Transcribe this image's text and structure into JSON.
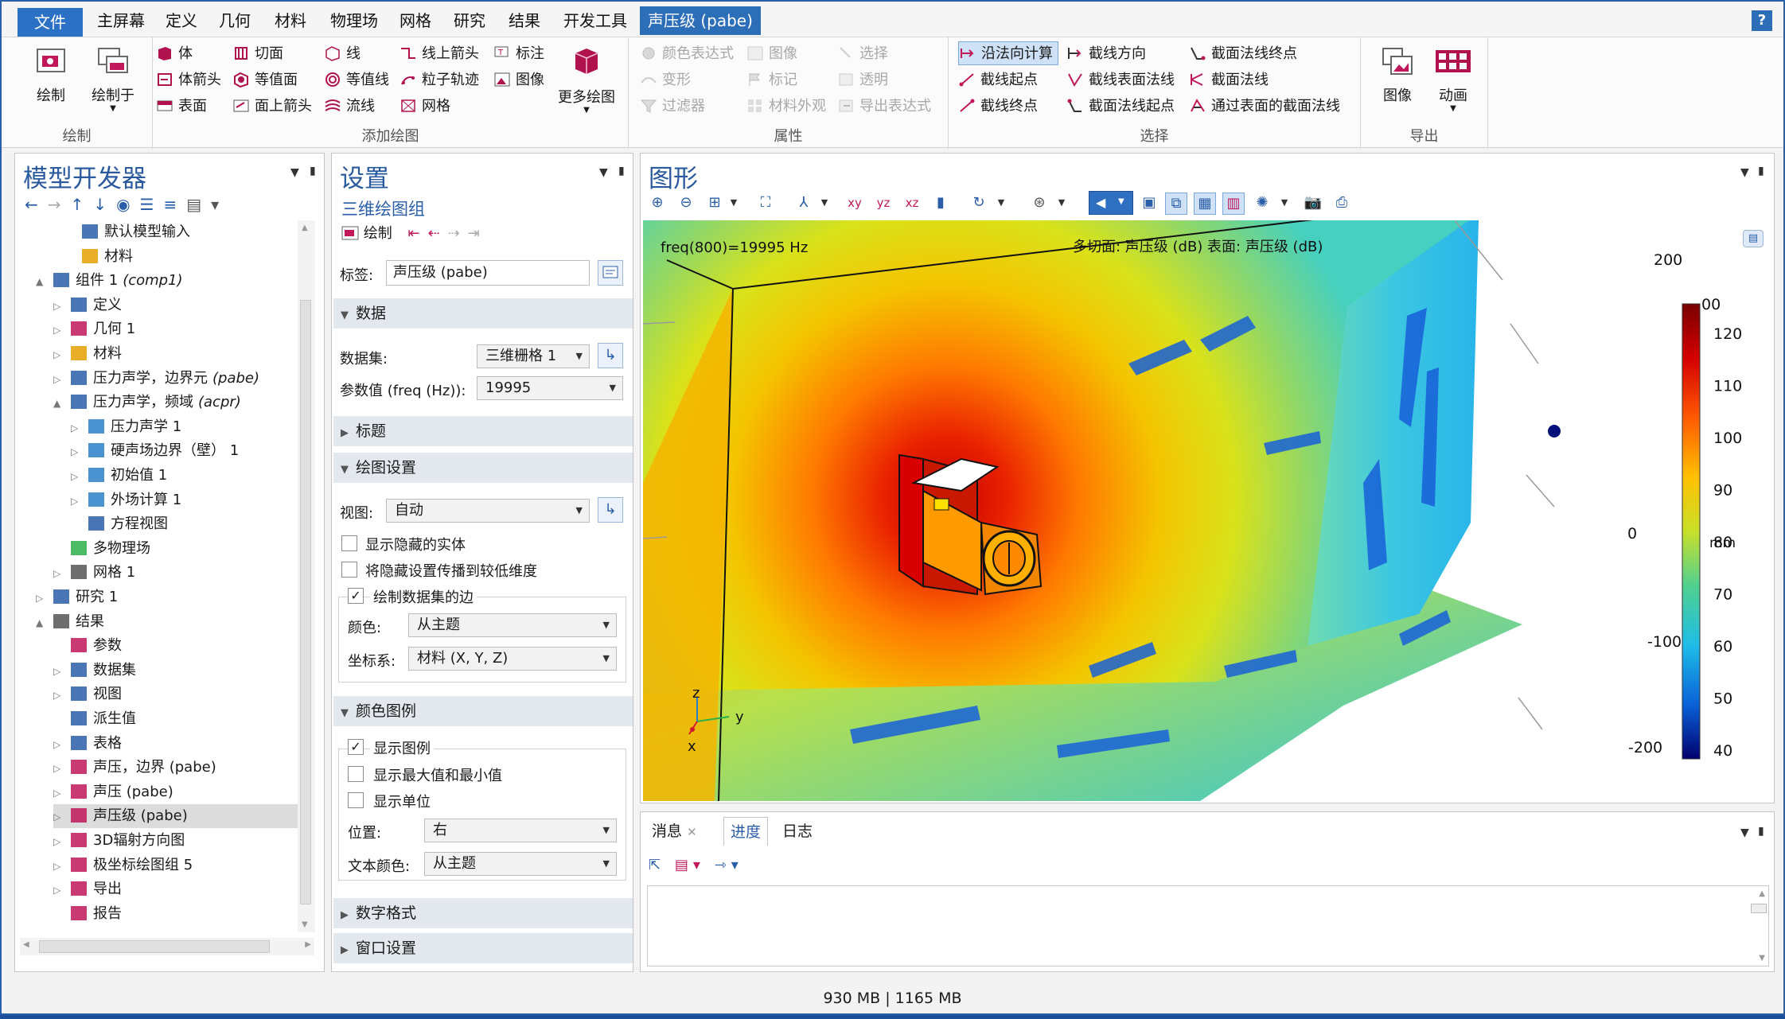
{
  "tabs": {
    "file": "文件",
    "home": "主屏幕",
    "definitions": "定义",
    "geometry": "几何",
    "materials": "材料",
    "physics": "物理场",
    "mesh": "网格",
    "study": "研究",
    "results": "结果",
    "developer": "开发工具",
    "contextual": "声压级 (pabe)",
    "help": "?"
  },
  "ribbon": {
    "plot_group": {
      "plot": "绘制",
      "plot_in": "绘制于",
      "label": "绘制"
    },
    "add_plot": {
      "label": "添加绘图",
      "col1": [
        "体",
        "体箭头",
        "表面"
      ],
      "col2": [
        "切面",
        "等值面",
        "面上箭头"
      ],
      "col3": [
        "线",
        "等值线",
        "流线"
      ],
      "col4": [
        "线上箭头",
        "粒子轨迹",
        "网格"
      ],
      "col5": [
        "标注",
        "图像"
      ],
      "more": "更多绘图"
    },
    "attributes": {
      "label": "属性",
      "col1": [
        "颜色表达式",
        "变形",
        "过滤器"
      ],
      "col2": [
        "图像",
        "标记",
        "材料外观"
      ],
      "col3": [
        "选择",
        "透明",
        "导出表达式"
      ]
    },
    "selection": {
      "label": "选择",
      "col1": [
        "沿法向计算",
        "截线起点",
        "截线终点"
      ],
      "col2": [
        "截线方向",
        "截线表面法线",
        "截面法线起点"
      ],
      "col3": [
        "截面法线终点",
        "截面法线",
        "通过表面的截面法线"
      ]
    },
    "export": {
      "label": "导出",
      "image": "图像",
      "animation": "动画"
    }
  },
  "model_builder": {
    "title": "模型开发器",
    "rows": [
      {
        "label": "默认模型输入",
        "indent": 0
      },
      {
        "label": "材料",
        "indent": 0
      },
      {
        "label": "组件 1",
        "suffix": "(comp1)",
        "indent": 0
      },
      {
        "label": "定义",
        "indent": 1
      },
      {
        "label": "几何 1",
        "indent": 1
      },
      {
        "label": "材料",
        "indent": 1
      },
      {
        "label": "压力声学，边界元",
        "suffix": "(pabe)",
        "indent": 1
      },
      {
        "label": "压力声学，频域",
        "suffix": "(acpr)",
        "indent": 1
      },
      {
        "label": "压力声学 1",
        "indent": 2
      },
      {
        "label": "硬声场边界（壁） 1",
        "indent": 2
      },
      {
        "label": "初始值 1",
        "indent": 2
      },
      {
        "label": "外场计算 1",
        "indent": 2
      },
      {
        "label": "方程视图",
        "indent": 2
      },
      {
        "label": "多物理场",
        "indent": 1
      },
      {
        "label": "网格 1",
        "indent": 1
      },
      {
        "label": "研究 1",
        "indent": 0
      },
      {
        "label": "结果",
        "indent": 0
      },
      {
        "label": "参数",
        "indent": 1
      },
      {
        "label": "数据集",
        "indent": 1
      },
      {
        "label": "视图",
        "indent": 1
      },
      {
        "label": "派生值",
        "indent": 1
      },
      {
        "label": "表格",
        "indent": 1
      },
      {
        "label": "声压，边界 (pabe)",
        "indent": 1
      },
      {
        "label": "声压 (pabe)",
        "indent": 1
      },
      {
        "label": "声压级 (pabe)",
        "indent": 1
      },
      {
        "label": "3D辐射方向图",
        "indent": 1
      },
      {
        "label": "极坐标绘图组 5",
        "indent": 1
      },
      {
        "label": "导出",
        "indent": 1
      },
      {
        "label": "报告",
        "indent": 1
      }
    ]
  },
  "settings": {
    "title": "设置",
    "subtitle": "三维绘图组",
    "plot_btn": "绘制",
    "label_caption": "标签:",
    "label_value": "声压级 (pabe)",
    "sec_data": "数据",
    "dataset_caption": "数据集:",
    "dataset_value": "三维栅格 1",
    "param_caption": "参数值 (freq (Hz)):",
    "param_value": "19995",
    "sec_title": "标题",
    "sec_plot_settings": "绘图设置",
    "view_caption": "视图:",
    "view_value": "自动",
    "chk_hidden": "显示隐藏的实体",
    "chk_propagate": "将隐藏设置传播到较低维度",
    "chk_edges": "绘制数据集的边",
    "color_caption": "颜色:",
    "color_value": "从主题",
    "frame_caption": "坐标系:",
    "frame_value": "材料  (X, Y, Z)",
    "sec_legend": "颜色图例",
    "chk_legend": "显示图例",
    "chk_maxmin": "显示最大值和最小值",
    "chk_units": "显示单位",
    "pos_caption": "位置:",
    "pos_value": "右",
    "textcolor_caption": "文本颜色:",
    "textcolor_value": "从主题",
    "sec_number": "数字格式",
    "sec_window": "窗口设置"
  },
  "graphics": {
    "title": "图形",
    "freq_label": "freq(800)=19995 Hz",
    "plot_title": "多切面: 声压级 (dB)  表面: 声压级 (dB)",
    "axis_ticks": [
      "200",
      "0",
      "-100",
      "-200"
    ],
    "axis_unit": "mm",
    "colorbar": [
      "120",
      "110",
      "100",
      "90",
      "80",
      "70",
      "60",
      "50",
      "40"
    ],
    "colorbar_top": "00",
    "triad": {
      "z": "z",
      "y": "y",
      "x": "x"
    }
  },
  "bottom": {
    "tabs": [
      "消息",
      "进度",
      "日志"
    ]
  },
  "status": "930 MB | 1165 MB"
}
